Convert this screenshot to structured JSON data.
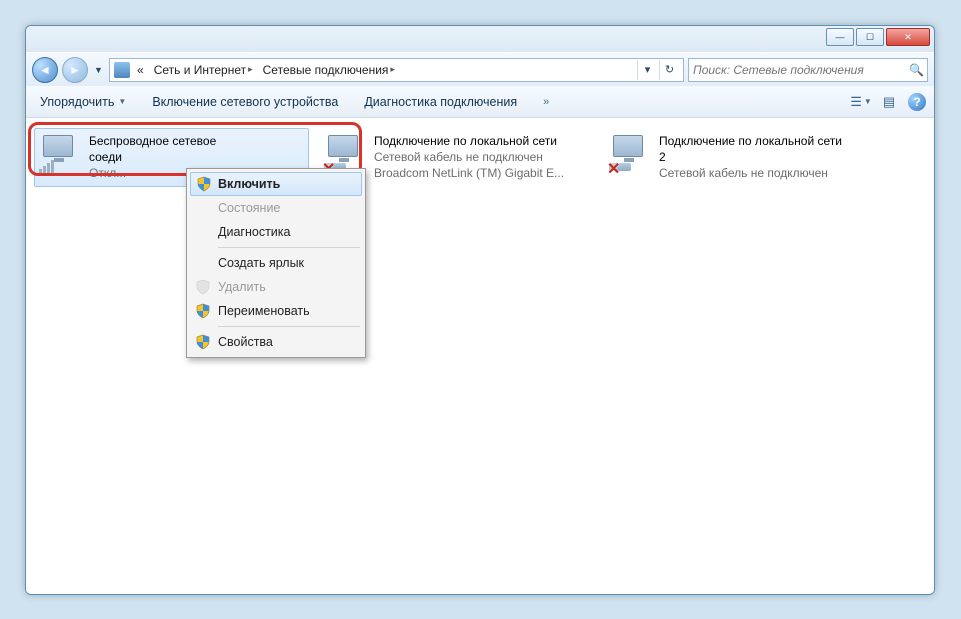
{
  "breadcrumb": {
    "seg1": "Сеть и Интернет",
    "seg2": "Сетевые подключения",
    "prefix": "«"
  },
  "search": {
    "placeholder": "Поиск: Сетевые подключения"
  },
  "toolbar": {
    "organize": "Упорядочить",
    "enable_device": "Включение сетевого устройства",
    "diag": "Диагностика подключения"
  },
  "conn": {
    "wifi": {
      "l1": "Беспроводное сетевое",
      "l2": "соеди",
      "l3": "Откл..."
    },
    "lan1": {
      "l1": "Подключение по локальной сети",
      "l2": "Сетевой кабель не подключен",
      "l3": "Broadcom NetLink (TM) Gigabit E..."
    },
    "lan2": {
      "l1": "Подключение по локальной сети",
      "l2": "2",
      "l3": "Сетевой кабель не подключен"
    }
  },
  "ctx": {
    "enable": "Включить",
    "status": "Состояние",
    "diag": "Диагностика",
    "shortcut": "Создать ярлык",
    "delete": "Удалить",
    "rename": "Переименовать",
    "props": "Свойства"
  }
}
